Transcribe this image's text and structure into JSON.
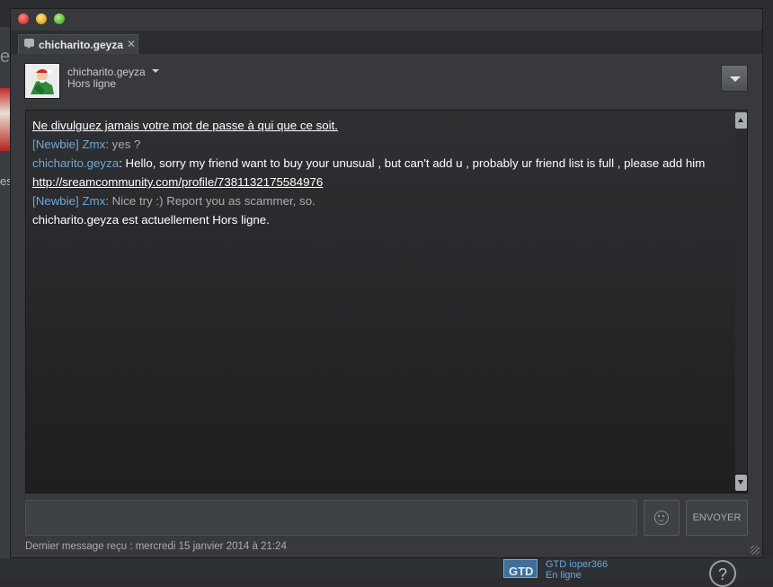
{
  "background": {
    "fragment_e": "e",
    "fragment_es": "es",
    "friend": {
      "avatar_text": "GTD",
      "name": "GTD ioper366",
      "status": "En ligne"
    },
    "help_glyph": "?"
  },
  "window": {
    "tab": {
      "icon": "chat-bubble-icon",
      "label": "chicharito.geyza",
      "close_glyph": "✕"
    },
    "header": {
      "name": "chicharito.geyza",
      "status": "Hors ligne"
    }
  },
  "chat": {
    "warning": "Ne divulguez jamais votre mot de passe à qui que ce soit.",
    "messages": [
      {
        "sender": "[Newbie] Zmx",
        "sep": ": ",
        "text": "yes ?"
      },
      {
        "sender": "chicharito.geyza",
        "sep": ": ",
        "text": "Hello, sorry my friend want to buy your unusual , but can't add u , probably ur friend list is full , please add him ",
        "link": "http://sreamcommunity.com/profile/7381132175584976"
      },
      {
        "sender": "[Newbie] Zmx",
        "sep": ": ",
        "text": "Nice try :) Report you as scammer, so."
      }
    ],
    "status_line": "chicharito.geyza est actuellement Hors ligne."
  },
  "composer": {
    "value": "",
    "placeholder": "",
    "send_label": "ENVOYER"
  },
  "footer": {
    "last_message": "Dernier message reçu : mercredi 15 janvier 2014 à 21:24"
  },
  "colors": {
    "accent_blue": "#6ea8d8",
    "window_bg": "#37393c",
    "log_bg": "#222325"
  }
}
